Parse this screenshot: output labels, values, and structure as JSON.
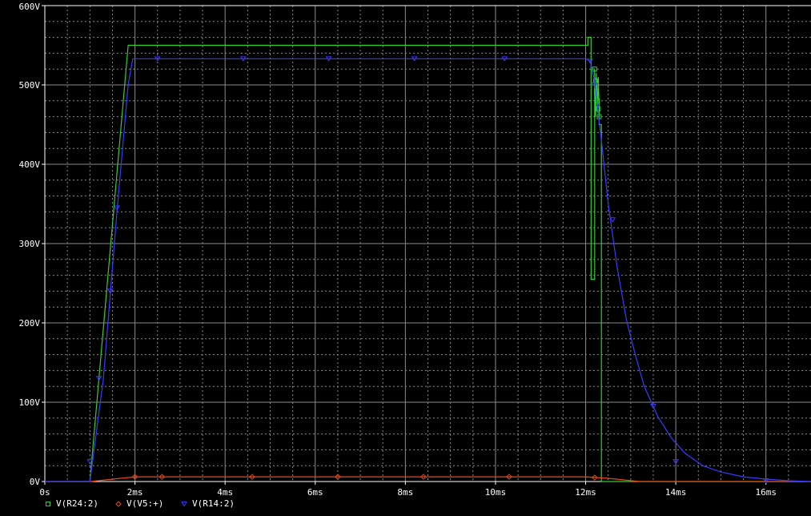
{
  "chart_data": {
    "type": "line",
    "title": "",
    "xlabel": "",
    "ylabel": "",
    "xlim": [
      0,
      17
    ],
    "ylim": [
      0,
      600
    ],
    "x_unit": "ms",
    "y_unit": "V",
    "x_ticks": [
      "0s",
      "2ms",
      "4ms",
      "6ms",
      "8ms",
      "10ms",
      "12ms",
      "14ms",
      "16ms"
    ],
    "y_ticks": [
      "0V",
      "100V",
      "200V",
      "300V",
      "400V",
      "500V",
      "600V"
    ],
    "grid": true,
    "legend_position": "bottom-left",
    "background": "#000000",
    "series": [
      {
        "name": "V(R24:2)",
        "color": "#2fd02f",
        "marker": "square",
        "x": [
          0,
          1.0,
          1.85,
          2.0,
          4,
          6,
          8,
          10,
          12.05,
          12.05,
          12.12,
          12.12,
          12.2,
          12.2,
          12.22,
          12.24,
          12.26,
          12.28,
          12.3,
          12.3,
          12.35,
          12.35,
          12.4,
          17
        ],
        "y": [
          0,
          0,
          550,
          550,
          550,
          550,
          550,
          550,
          550,
          560,
          560,
          255,
          255,
          520,
          460,
          515,
          465,
          510,
          470,
          450,
          450,
          0,
          0,
          0
        ],
        "marker_x": [
          12.2,
          12.22,
          12.24,
          12.26,
          12.28,
          12.3
        ],
        "marker_y": [
          520,
          505,
          492,
          480,
          470,
          460
        ]
      },
      {
        "name": "V(V5:+)",
        "color": "#e84818",
        "marker": "diamond",
        "x": [
          0,
          1.0,
          2.0,
          4,
          6,
          8,
          10,
          12.0,
          12.5,
          13.2,
          17
        ],
        "y": [
          0,
          0,
          6,
          6,
          6,
          6,
          6,
          6,
          4,
          0,
          0
        ],
        "marker_x": [
          2.0,
          2.6,
          4.6,
          6.5,
          8.4,
          10.3,
          12.2
        ],
        "marker_y": [
          6,
          6,
          6,
          6,
          6,
          6,
          5
        ]
      },
      {
        "name": "V(R14:2)",
        "color": "#3a3aff",
        "marker": "triangle",
        "x": [
          0,
          1.0,
          1.3,
          1.6,
          1.85,
          1.95,
          4,
          6,
          8,
          10,
          12.0,
          12.1,
          12.2,
          12.35,
          12.5,
          12.7,
          12.9,
          13.1,
          13.3,
          13.6,
          13.9,
          14.2,
          14.6,
          15.0,
          15.5,
          16.0,
          16.5,
          17
        ],
        "y": [
          0,
          0,
          130,
          340,
          500,
          533,
          533,
          533,
          533,
          533,
          533,
          530,
          505,
          430,
          350,
          270,
          205,
          160,
          120,
          82,
          55,
          36,
          20,
          12,
          6,
          3,
          1,
          0
        ],
        "marker_x": [
          1.0,
          1.2,
          1.45,
          1.6,
          2.5,
          4.4,
          6.3,
          8.2,
          10.2,
          12.1,
          12.2,
          12.6,
          13.5,
          14.0,
          16.0
        ],
        "marker_y": [
          25,
          130,
          240,
          345,
          533,
          533,
          533,
          533,
          533,
          530,
          500,
          330,
          95,
          25,
          1
        ]
      }
    ]
  }
}
